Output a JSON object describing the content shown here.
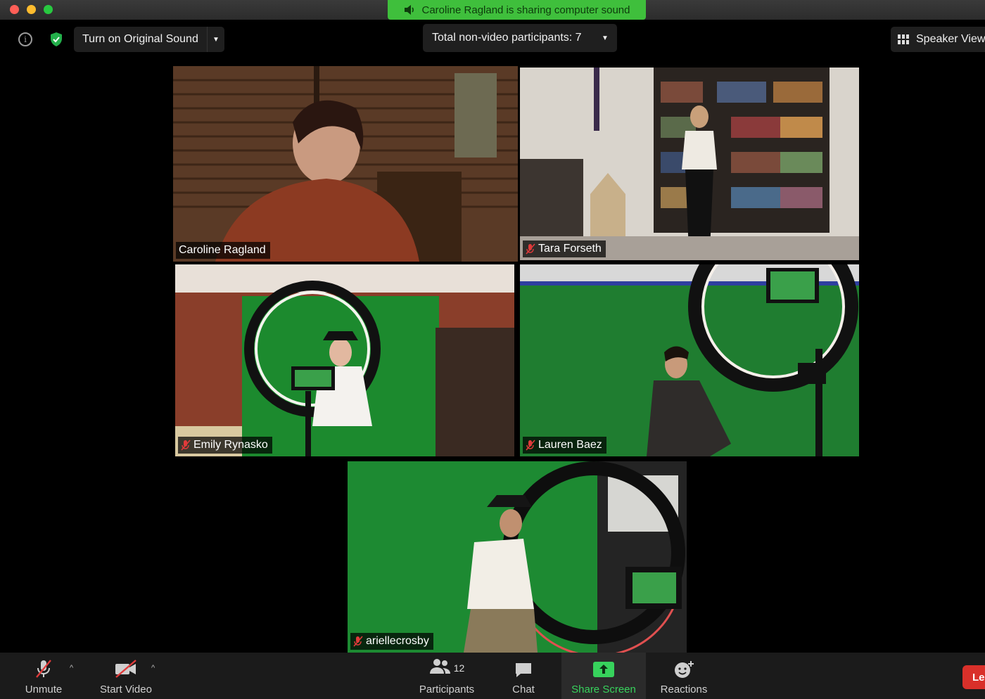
{
  "window": {
    "share_banner": "Caroline Ragland is sharing computer sound"
  },
  "topbar": {
    "original_sound_label": "Turn on Original Sound",
    "non_video_label": "Total non-video participants: 7",
    "view_label": "Speaker View"
  },
  "participants": [
    {
      "name": "Caroline Ragland",
      "muted": false,
      "active_speaker": true
    },
    {
      "name": "Tara Forseth",
      "muted": true
    },
    {
      "name": "Emily Rynasko",
      "muted": true
    },
    {
      "name": "Lauren Baez",
      "muted": true
    },
    {
      "name": "ariellecrosby",
      "muted": true
    }
  ],
  "toolbar": {
    "unmute_label": "Unmute",
    "start_video_label": "Start Video",
    "participants_label": "Participants",
    "participants_count": "12",
    "chat_label": "Chat",
    "share_screen_label": "Share Screen",
    "reactions_label": "Reactions",
    "leave_label": "Leave"
  },
  "colors": {
    "share_green": "#3fbf3c",
    "active_outline": "#d9e87a",
    "leave_red": "#d9302a"
  }
}
